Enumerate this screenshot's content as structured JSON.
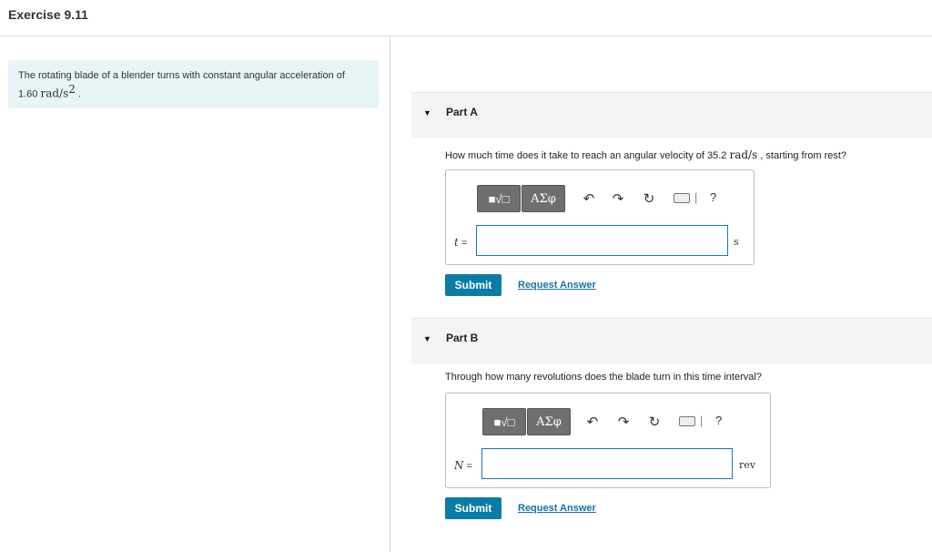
{
  "header": {
    "title": "Exercise 9.11"
  },
  "intro": {
    "text": "The rotating blade of a blender turns with constant angular acceleration of",
    "value": "1.60",
    "unit": "rad/s",
    "unit_exp": "2",
    "period": "."
  },
  "toolbar": {
    "template_label": "■√□",
    "greek_label": "ΑΣφ",
    "undo_icon": "undo-icon",
    "redo_icon": "redo-icon",
    "reset_icon": "reset-icon",
    "keyboard_icon": "keyboard-icon",
    "help_label": "?"
  },
  "parts": [
    {
      "label": "Part A",
      "question_pre": "How much time does it take to reach an angular velocity of 35.2",
      "question_unit": "rad/s",
      "question_post": ", starting from rest?",
      "variable": "t",
      "input_value": "",
      "unit": "s",
      "submit_label": "Submit",
      "request_label": "Request Answer"
    },
    {
      "label": "Part B",
      "question": "Through how many revolutions does the blade turn in this time interval?",
      "variable": "N",
      "input_value": "",
      "unit": "rev",
      "submit_label": "Submit",
      "request_label": "Request Answer"
    }
  ],
  "colors": {
    "accent": "#0b7ca6",
    "link": "#1a6fa8",
    "intro_bg": "#e8f5f6",
    "input_border": "#1b79a3"
  }
}
